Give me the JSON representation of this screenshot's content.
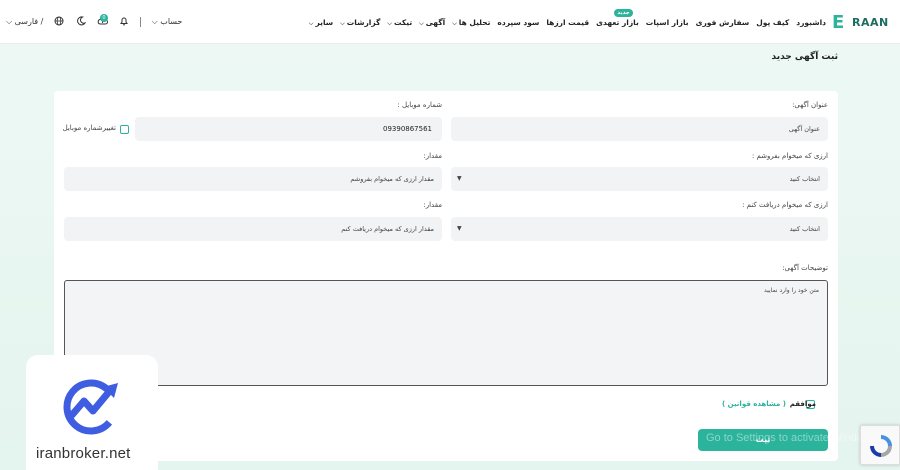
{
  "brand": {
    "logo_ex": "E",
    "logo_name": "RAAN"
  },
  "nav": {
    "items": [
      {
        "label": "داشبورد",
        "chevron": false
      },
      {
        "label": "کیف پول",
        "chevron": false
      },
      {
        "label": "سفارش فوری",
        "chevron": false
      },
      {
        "label": "بازار اسپات",
        "chevron": false
      },
      {
        "label": "بازار تعهدی",
        "chevron": false,
        "badge": "جدید"
      },
      {
        "label": "قیمت ارزها",
        "chevron": false
      },
      {
        "label": "سود سپرده",
        "chevron": false
      },
      {
        "label": "تحلیل ها",
        "chevron": true
      },
      {
        "label": "آگهی",
        "chevron": true
      },
      {
        "label": "تیکت",
        "chevron": true
      },
      {
        "label": "گزارشات",
        "chevron": true
      },
      {
        "label": "سایر",
        "chevron": true
      }
    ]
  },
  "tools": {
    "language": "فارسی /",
    "account": "حساب",
    "notif_count": "0"
  },
  "page": {
    "title": "ثبت آگهی جدید"
  },
  "form": {
    "title_label": "عنوان آگهی:",
    "title_placeholder": "عنوان آگهی",
    "mobile_label": "شماره موبایل :",
    "mobile_value": "09390867561",
    "change_mobile_label": "تغییرشماره موبایل",
    "sell_currency_label": "ارزی که میخوام بفروشم :",
    "sell_currency_value": "انتخاب کنید",
    "sell_amount_label": "مقدار:",
    "sell_amount_placeholder": "مقدار ارزی که میخوام بفروشم",
    "buy_currency_label": "ارزی که میخوام دریافت کنم :",
    "buy_currency_value": "انتخاب کنید",
    "buy_amount_label": "مقدار:",
    "buy_amount_placeholder": "مقدار ارزی که میخوام دریافت کنم",
    "description_label": "توضیحات آگهی:",
    "description_placeholder": "متن خود را وارد نمایید",
    "agree_label": "موافقم",
    "rules_link": "( مشاهده قوانین )",
    "submit_label": "ثبت"
  },
  "overlay": {
    "windows_watermark": "Go to Settings to activate Windows.",
    "broker_site": "iranbroker.net"
  },
  "colors": {
    "accent": "#2bb39b",
    "broker_blue": "#3f5de0"
  }
}
